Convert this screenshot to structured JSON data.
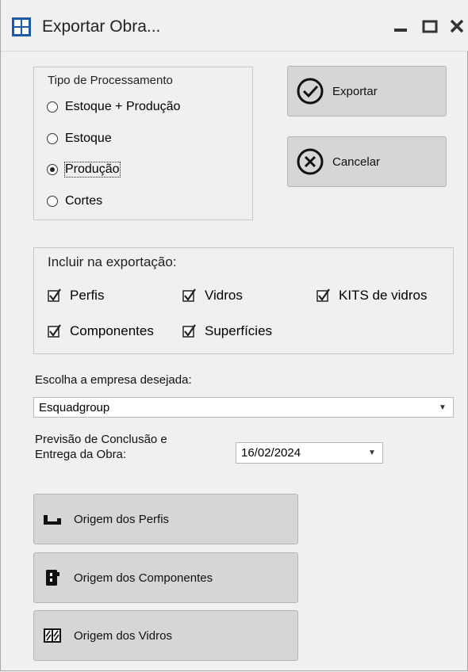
{
  "window": {
    "title": "Exportar Obra..."
  },
  "processing": {
    "legend": "Tipo de Processamento",
    "options": [
      {
        "label": "Estoque + Produção",
        "selected": false
      },
      {
        "label": "Estoque",
        "selected": false
      },
      {
        "label": "Produção",
        "selected": true
      },
      {
        "label": "Cortes",
        "selected": false
      }
    ]
  },
  "actions": {
    "export_label": "Exportar",
    "cancel_label": "Cancelar"
  },
  "include": {
    "legend": "Incluir na exportação:",
    "items": [
      {
        "label": "Perfis",
        "checked": true
      },
      {
        "label": "Vidros",
        "checked": true
      },
      {
        "label": "KITS de vidros",
        "checked": true
      },
      {
        "label": "Componentes",
        "checked": true
      },
      {
        "label": "Superfícies",
        "checked": true
      }
    ]
  },
  "company": {
    "label": "Escolha a empresa desejada:",
    "value": "Esquadgroup"
  },
  "forecast": {
    "label_line1": "Previsão de Conclusão e",
    "label_line2": "Entrega da Obra:",
    "date": "16/02/2024"
  },
  "origins": {
    "profiles_label": "Origem dos Perfis",
    "components_label": "Origem dos Componentes",
    "glass_label": "Origem dos Vidros"
  },
  "colors": {
    "accent": "#1f5aa6",
    "button_bg": "#d6d6d6",
    "window_bg": "#f0f0f0"
  }
}
